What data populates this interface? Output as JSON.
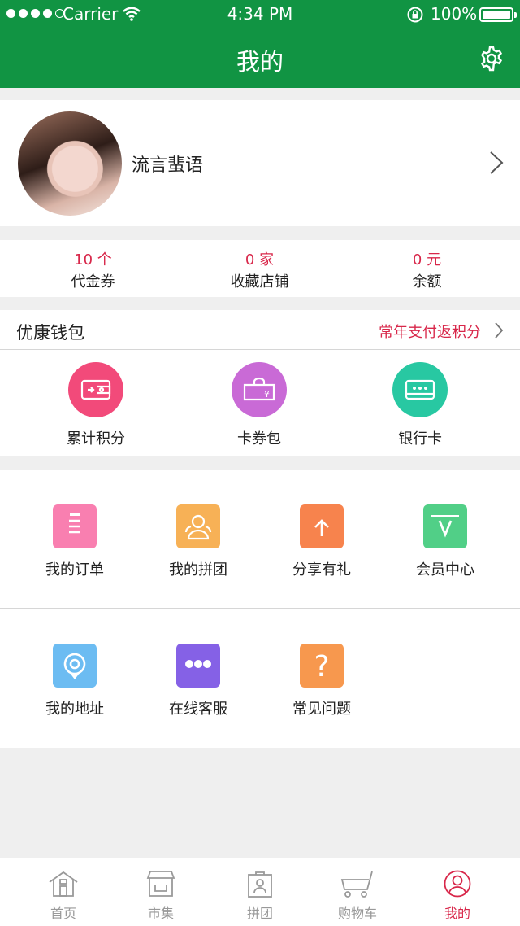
{
  "status_bar": {
    "carrier": "Carrier",
    "time": "4:34 PM",
    "battery": "100%"
  },
  "header": {
    "title": "我的"
  },
  "profile": {
    "username": "流言蜚语"
  },
  "stats": [
    {
      "value": "10 个",
      "label": "代金券"
    },
    {
      "value": "0 家",
      "label": "收藏店铺"
    },
    {
      "value": "0 元",
      "label": "余额"
    }
  ],
  "wallet": {
    "title": "优康钱包",
    "link": "常年支付返积分",
    "items": [
      {
        "label": "累计积分",
        "icon": "wallet-icon",
        "color": "#f24a7a"
      },
      {
        "label": "卡券包",
        "icon": "coupon-bag-icon",
        "color": "#c96ad6"
      },
      {
        "label": "银行卡",
        "icon": "bank-card-icon",
        "color": "#28c8a2"
      }
    ]
  },
  "grid": [
    {
      "label": "我的订单",
      "icon": "order-list-icon",
      "color": "#f97fb0"
    },
    {
      "label": "我的拼团",
      "icon": "group-people-icon",
      "color": "#f7b156"
    },
    {
      "label": "分享有礼",
      "icon": "gift-icon",
      "color": "#f7834d"
    },
    {
      "label": "会员中心",
      "icon": "member-v-icon",
      "color": "#51cf87"
    },
    {
      "label": "我的地址",
      "icon": "location-pin-icon",
      "color": "#6cbcf2"
    },
    {
      "label": "在线客服",
      "icon": "chat-bubble-icon",
      "color": "#8561e6"
    },
    {
      "label": "常见问题",
      "icon": "question-icon",
      "color": "#f7984e"
    }
  ],
  "tabs": [
    {
      "label": "首页",
      "icon": "home-icon",
      "active": false
    },
    {
      "label": "市集",
      "icon": "market-icon",
      "active": false
    },
    {
      "label": "拼团",
      "icon": "group-bag-icon",
      "active": false
    },
    {
      "label": "购物车",
      "icon": "cart-icon",
      "active": false
    },
    {
      "label": "我的",
      "icon": "profile-icon",
      "active": true
    }
  ],
  "colors": {
    "header": "#119443",
    "accent": "#d8274a",
    "background": "#efefef"
  }
}
